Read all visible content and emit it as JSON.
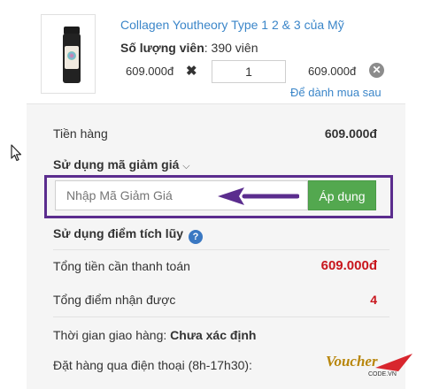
{
  "product": {
    "title": "Collagen Youtheory Type 1 2 & 3 của Mỹ",
    "quantity_label": "Số lượng viên",
    "quantity_value": ": 390 viên",
    "unit_price": "609.000đ",
    "times_symbol": "✖",
    "quantity_input": "1",
    "line_total": "609.000đ",
    "remove_symbol": "✕",
    "save_for_later": "Để dành mua sau"
  },
  "summary": {
    "subtotal_label": "Tiền hàng",
    "subtotal_value": "609.000đ",
    "coupon_toggle": "Sử dụng mã giảm giá",
    "coupon_chevron": "⌵",
    "coupon_placeholder": "Nhập Mã Giảm Giá",
    "apply_label": "Áp dụng",
    "points_label": "Sử dụng điểm tích lũy",
    "help_symbol": "?",
    "total_label": "Tổng tiền cần thanh toán",
    "total_value": "609.000đ",
    "points_earned_label": "Tổng điểm nhận được",
    "points_earned_value": "4",
    "delivery_label": "Thời gian giao hàng:",
    "delivery_value": "Chưa xác định",
    "phone_order_label": "Đặt hàng qua điện thoại (8h-17h30):"
  },
  "watermark": {
    "logo_text": "Voucher",
    "logo_subtext": "CODE.VN"
  },
  "colors": {
    "link": "#3b86c9",
    "apply_button": "#53a84f",
    "highlight_border": "#5b2d8e",
    "total_red": "#c8161d",
    "help_icon": "#3a78c2"
  }
}
